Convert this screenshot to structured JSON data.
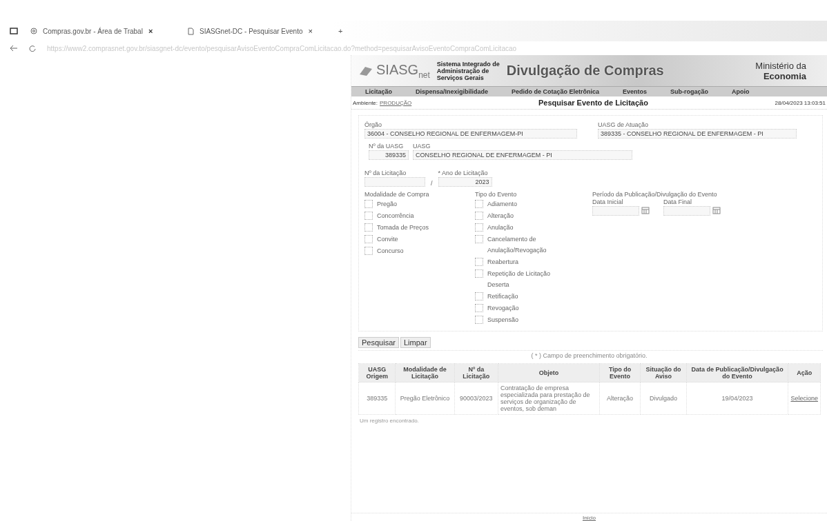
{
  "browser": {
    "tabs": [
      {
        "title": "Compras.gov.br - Área de Trabal",
        "selected": false
      },
      {
        "title": "SIASGnet-DC - Pesquisar Evento",
        "selected": true
      }
    ],
    "tab_close": "×",
    "new_tab": "+",
    "url": "https://www2.comprasnet.gov.br/siasgnet-dc/evento/pesquisarAvisoEventoCompraComLicitacao.do?method=pesquisarAvisoEventoCompraComLicitacao"
  },
  "header": {
    "logo": "SIASG",
    "logo_sub": "net",
    "system_name": [
      "Sistema Integrado de",
      "Administração de",
      "Serviços Gerais"
    ],
    "banner": "Divulgação de Compras",
    "ministry": "Ministério da",
    "ministry_bold": "Economia"
  },
  "nav": [
    "Licitação",
    "Dispensa/Inexigibilidade",
    "Pedido de Cotação Eletrônica",
    "Eventos",
    "Sub-rogação",
    "Apoio"
  ],
  "status": {
    "environment_label": "Ambiente:",
    "environment": "PRODUÇÃO",
    "title": "Pesquisar Evento de Licitação",
    "datetime": "28/04/2023 13:03:51"
  },
  "form": {
    "orgao_label": "Órgão",
    "orgao": "36004 - CONSELHO REGIONAL DE ENFERMAGEM-PI",
    "uasg_atuacao_label": "UASG de Atuação",
    "uasg_atuacao": "389335 - CONSELHO REGIONAL DE ENFERMAGEM - PI",
    "uasg_num_label": "Nº da UASG",
    "uasg_num": "389335",
    "uasg_label": "UASG",
    "uasg": "CONSELHO REGIONAL DE ENFERMAGEM - PI",
    "licitacao_label": "Nº da Licitação",
    "separator": "/",
    "ano_label": "* Ano de Licitação",
    "ano": "2023",
    "modalidade_label": "Modalidade de Compra",
    "modalidades": [
      {
        "label": "Pregão",
        "checked": false
      },
      {
        "label": "Concorrência",
        "checked": false
      },
      {
        "label": "Tomada de Preços",
        "checked": false
      },
      {
        "label": "Convite",
        "checked": false
      },
      {
        "label": "Concurso",
        "checked": false
      }
    ],
    "tipo_label": "Tipo do Evento",
    "tipos": [
      {
        "label": "Adiamento",
        "checked": false
      },
      {
        "label": "Alteração",
        "checked": false
      },
      {
        "label": "Anulação",
        "checked": false
      },
      {
        "label": "Cancelamento de Anulação/Revogação",
        "checked": false
      },
      {
        "label": "Reabertura",
        "checked": false
      },
      {
        "label": "Repetição de Licitação Deserta",
        "checked": false
      },
      {
        "label": "Retificação",
        "checked": false
      },
      {
        "label": "Revogação",
        "checked": false
      },
      {
        "label": "Suspensão",
        "checked": false
      }
    ],
    "periodo_label": "Período da Publicação/Divulgação do Evento",
    "data_inicial_label": "Data Inicial",
    "data_final_label": "Data Final",
    "buttons": [
      "Pesquisar",
      "Limpar"
    ],
    "required_note": "( * ) Campo de preenchimento obrigatório."
  },
  "table": {
    "columns": [
      "UASG Origem",
      "Modalidade de Licitação",
      "Nº da Licitação",
      "Objeto",
      "Tipo do Evento",
      "Situação do Aviso",
      "Data de Publicação/Divulgação do Evento",
      "Ação"
    ],
    "rows": [
      [
        "389335",
        "Pregão Eletrônico",
        "90003/2023",
        "Contratação de empresa especializada para prestação de serviços de organização de eventos, sob deman",
        "Alteração",
        "Divulgado",
        "19/04/2023",
        "Selecione"
      ]
    ]
  },
  "result_count": "Um registro encontrado.",
  "footer": "Início"
}
